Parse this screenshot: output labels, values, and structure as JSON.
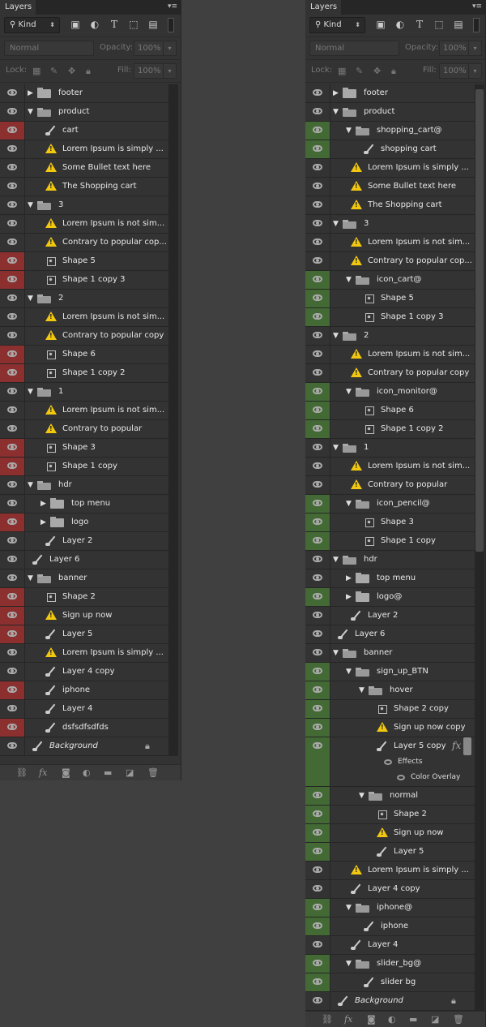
{
  "tab_label": "Layers",
  "filter": {
    "kind_label": "Kind"
  },
  "blend": {
    "mode": "Normal",
    "opacity_label": "Opacity:",
    "opacity": "100%",
    "lock_label": "Lock:",
    "fill_label": "Fill:",
    "fill": "100%"
  },
  "colors": {
    "red": "#8c2f2f",
    "green": "#436a34",
    "row": "#333333"
  },
  "left": {
    "layers": [
      {
        "name": "footer",
        "d": 0,
        "k": "folder"
      },
      {
        "name": "product",
        "d": 0,
        "k": "folder-open"
      },
      {
        "name": "cart",
        "d": 1,
        "k": "brush",
        "v": "red"
      },
      {
        "name": "Lorem Ipsum is simply ...",
        "d": 1,
        "k": "text"
      },
      {
        "name": "Some Bullet text here",
        "d": 1,
        "k": "text"
      },
      {
        "name": "The Shopping cart",
        "d": 1,
        "k": "text"
      },
      {
        "name": "3",
        "d": 0,
        "k": "folder-open"
      },
      {
        "name": "Lorem Ipsum is not sim...",
        "d": 1,
        "k": "text"
      },
      {
        "name": "Contrary to popular cop...",
        "d": 1,
        "k": "text"
      },
      {
        "name": "Shape 5",
        "d": 1,
        "k": "shape",
        "v": "red"
      },
      {
        "name": "Shape 1 copy 3",
        "d": 1,
        "k": "shape",
        "v": "red"
      },
      {
        "name": "2",
        "d": 0,
        "k": "folder-open"
      },
      {
        "name": "Lorem Ipsum is not sim...",
        "d": 1,
        "k": "text"
      },
      {
        "name": "Contrary to popular copy",
        "d": 1,
        "k": "text"
      },
      {
        "name": "Shape 6",
        "d": 1,
        "k": "shape",
        "v": "red"
      },
      {
        "name": "Shape 1 copy 2",
        "d": 1,
        "k": "shape",
        "v": "red"
      },
      {
        "name": "1",
        "d": 0,
        "k": "folder-open"
      },
      {
        "name": "Lorem Ipsum is not sim...",
        "d": 1,
        "k": "text"
      },
      {
        "name": "Contrary to popular",
        "d": 1,
        "k": "text"
      },
      {
        "name": "Shape 3",
        "d": 1,
        "k": "shape",
        "v": "red"
      },
      {
        "name": "Shape 1 copy",
        "d": 1,
        "k": "shape",
        "v": "red"
      },
      {
        "name": "hdr",
        "d": 0,
        "k": "folder-open"
      },
      {
        "name": "top menu",
        "d": 1,
        "k": "folder"
      },
      {
        "name": "logo",
        "d": 1,
        "k": "folder",
        "v": "red"
      },
      {
        "name": "Layer 2",
        "d": 1,
        "k": "brush"
      },
      {
        "name": "Layer 6",
        "d": 0,
        "k": "brush"
      },
      {
        "name": "banner",
        "d": 0,
        "k": "folder-open"
      },
      {
        "name": "Shape 2",
        "d": 1,
        "k": "shape",
        "v": "red"
      },
      {
        "name": "Sign up now",
        "d": 1,
        "k": "text",
        "v": "red"
      },
      {
        "name": "Layer 5",
        "d": 1,
        "k": "brush",
        "v": "red"
      },
      {
        "name": "Lorem Ipsum is simply ...",
        "d": 1,
        "k": "text"
      },
      {
        "name": "Layer 4 copy",
        "d": 1,
        "k": "brush"
      },
      {
        "name": "iphone",
        "d": 1,
        "k": "brush",
        "v": "red"
      },
      {
        "name": "Layer 4",
        "d": 1,
        "k": "brush"
      },
      {
        "name": "dsfsdfsdfds",
        "d": 1,
        "k": "brush",
        "v": "red"
      },
      {
        "name": "Background",
        "d": 0,
        "k": "brush",
        "italic": true,
        "lock": true
      }
    ]
  },
  "right": {
    "layers": [
      {
        "name": "footer",
        "d": 0,
        "k": "folder"
      },
      {
        "name": "product",
        "d": 0,
        "k": "folder-open"
      },
      {
        "name": "shopping_cart@",
        "d": 1,
        "k": "folder-open",
        "v": "green"
      },
      {
        "name": "shopping cart",
        "d": 2,
        "k": "brush",
        "v": "green"
      },
      {
        "name": "Lorem Ipsum is simply ...",
        "d": 1,
        "k": "text"
      },
      {
        "name": "Some Bullet text here",
        "d": 1,
        "k": "text"
      },
      {
        "name": "The Shopping cart",
        "d": 1,
        "k": "text"
      },
      {
        "name": "3",
        "d": 0,
        "k": "folder-open"
      },
      {
        "name": "Lorem Ipsum is not sim...",
        "d": 1,
        "k": "text"
      },
      {
        "name": "Contrary to popular cop...",
        "d": 1,
        "k": "text"
      },
      {
        "name": "icon_cart@",
        "d": 1,
        "k": "folder-open",
        "v": "green"
      },
      {
        "name": "Shape 5",
        "d": 2,
        "k": "shape",
        "v": "green"
      },
      {
        "name": "Shape 1 copy 3",
        "d": 2,
        "k": "shape",
        "v": "green"
      },
      {
        "name": "2",
        "d": 0,
        "k": "folder-open"
      },
      {
        "name": "Lorem Ipsum is not sim...",
        "d": 1,
        "k": "text"
      },
      {
        "name": "Contrary to popular copy",
        "d": 1,
        "k": "text"
      },
      {
        "name": "icon_monitor@",
        "d": 1,
        "k": "folder-open",
        "v": "green"
      },
      {
        "name": "Shape 6",
        "d": 2,
        "k": "shape",
        "v": "green"
      },
      {
        "name": "Shape 1 copy 2",
        "d": 2,
        "k": "shape",
        "v": "green"
      },
      {
        "name": "1",
        "d": 0,
        "k": "folder-open"
      },
      {
        "name": "Lorem Ipsum is not sim...",
        "d": 1,
        "k": "text"
      },
      {
        "name": "Contrary to popular",
        "d": 1,
        "k": "text"
      },
      {
        "name": "icon_pencil@",
        "d": 1,
        "k": "folder-open",
        "v": "green"
      },
      {
        "name": "Shape 3",
        "d": 2,
        "k": "shape",
        "v": "green"
      },
      {
        "name": "Shape 1 copy",
        "d": 2,
        "k": "shape",
        "v": "green"
      },
      {
        "name": "hdr",
        "d": 0,
        "k": "folder-open"
      },
      {
        "name": "top menu",
        "d": 1,
        "k": "folder"
      },
      {
        "name": "logo@",
        "d": 1,
        "k": "folder",
        "v": "green"
      },
      {
        "name": "Layer 2",
        "d": 1,
        "k": "brush"
      },
      {
        "name": "Layer 6",
        "d": 0,
        "k": "brush"
      },
      {
        "name": "banner",
        "d": 0,
        "k": "folder-open"
      },
      {
        "name": "sign_up_BTN",
        "d": 1,
        "k": "folder-open",
        "v": "green"
      },
      {
        "name": "hover",
        "d": 2,
        "k": "folder-open",
        "v": "green"
      },
      {
        "name": "Shape 2 copy",
        "d": 3,
        "k": "shape",
        "v": "green"
      },
      {
        "name": "Sign up now copy",
        "d": 3,
        "k": "text",
        "v": "green"
      },
      {
        "name": "Layer 5 copy",
        "d": 3,
        "k": "brush",
        "v": "green",
        "fx": "fx",
        "effects": [
          "Effects",
          "Color Overlay"
        ]
      },
      {
        "name": "normal",
        "d": 2,
        "k": "folder-open",
        "v": "green"
      },
      {
        "name": "Shape 2",
        "d": 3,
        "k": "shape",
        "v": "green"
      },
      {
        "name": "Sign up now",
        "d": 3,
        "k": "text",
        "v": "green"
      },
      {
        "name": "Layer 5",
        "d": 3,
        "k": "brush",
        "v": "green"
      },
      {
        "name": "Lorem Ipsum is simply ...",
        "d": 1,
        "k": "text"
      },
      {
        "name": "Layer 4 copy",
        "d": 1,
        "k": "brush"
      },
      {
        "name": "iphone@",
        "d": 1,
        "k": "folder-open",
        "v": "green"
      },
      {
        "name": "iphone",
        "d": 2,
        "k": "brush",
        "v": "green"
      },
      {
        "name": "Layer 4",
        "d": 1,
        "k": "brush"
      },
      {
        "name": "slider_bg@",
        "d": 1,
        "k": "folder-open",
        "v": "green"
      },
      {
        "name": "slider bg",
        "d": 2,
        "k": "brush",
        "v": "green"
      },
      {
        "name": "Background",
        "d": 0,
        "k": "brush",
        "italic": true,
        "lock": true
      }
    ]
  }
}
